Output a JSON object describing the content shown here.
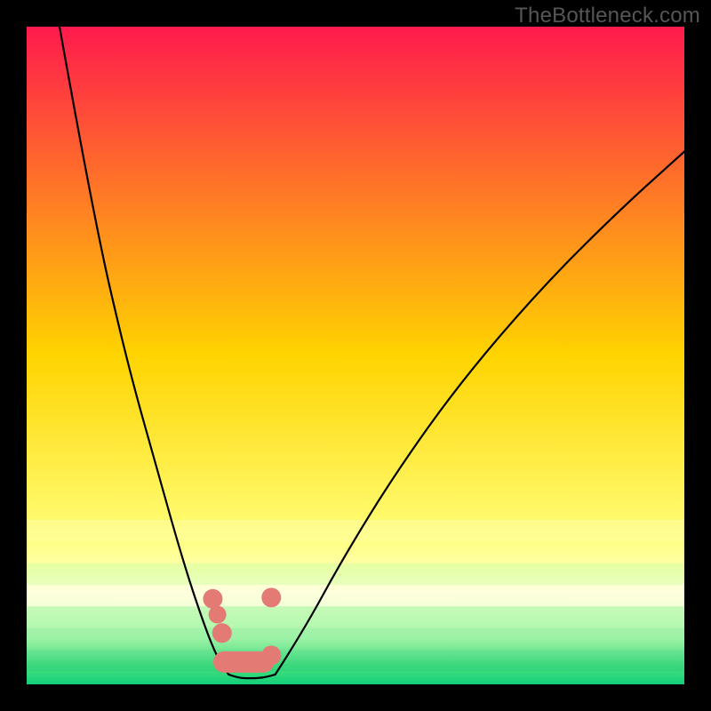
{
  "watermark": "TheBottleneck.com",
  "chart_data": {
    "type": "line",
    "title": "",
    "xlabel": "",
    "ylabel": "",
    "xlim": [
      0,
      1
    ],
    "ylim": [
      0,
      1
    ],
    "legend": null,
    "grid": false,
    "background": {
      "gradient_stops": [
        {
          "offset": 0.0,
          "color": "#ff1a4d"
        },
        {
          "offset": 0.5,
          "color": "#ffd400"
        },
        {
          "offset": 0.78,
          "color": "#ffff7a"
        },
        {
          "offset": 0.86,
          "color": "#ffffd0"
        },
        {
          "offset": 0.93,
          "color": "#c9ffb4"
        },
        {
          "offset": 0.97,
          "color": "#4fe07c"
        },
        {
          "offset": 1.0,
          "color": "#11d07a"
        }
      ],
      "band_y_range": [
        0.75,
        0.98
      ]
    },
    "series": [
      {
        "name": "left-curve",
        "x": [
          0.05,
          0.1,
          0.15,
          0.2,
          0.24,
          0.27,
          0.29,
          0.307
        ],
        "y": [
          0.0,
          0.28,
          0.5,
          0.68,
          0.82,
          0.91,
          0.96,
          0.985
        ]
      },
      {
        "name": "right-curve",
        "x": [
          0.378,
          0.42,
          0.48,
          0.56,
          0.66,
          0.78,
          0.9,
          1.0
        ],
        "y": [
          0.985,
          0.92,
          0.81,
          0.68,
          0.54,
          0.4,
          0.28,
          0.19
        ]
      },
      {
        "name": "trough",
        "x": [
          0.307,
          0.32,
          0.34,
          0.36,
          0.378
        ],
        "y": [
          0.985,
          0.99,
          0.991,
          0.99,
          0.985
        ]
      }
    ],
    "markers": [
      {
        "x": 0.283,
        "y": 0.87,
        "r": 11
      },
      {
        "x": 0.29,
        "y": 0.894,
        "r": 10
      },
      {
        "x": 0.297,
        "y": 0.922,
        "r": 11
      },
      {
        "x": 0.372,
        "y": 0.868,
        "r": 11
      },
      {
        "x": 0.344,
        "y": 0.966,
        "r": 12
      },
      {
        "x": 0.36,
        "y": 0.966,
        "r": 12
      },
      {
        "x": 0.372,
        "y": 0.956,
        "r": 11
      }
    ],
    "capsule": {
      "x0": 0.3,
      "x1": 0.355,
      "y": 0.966,
      "r": 12
    }
  }
}
